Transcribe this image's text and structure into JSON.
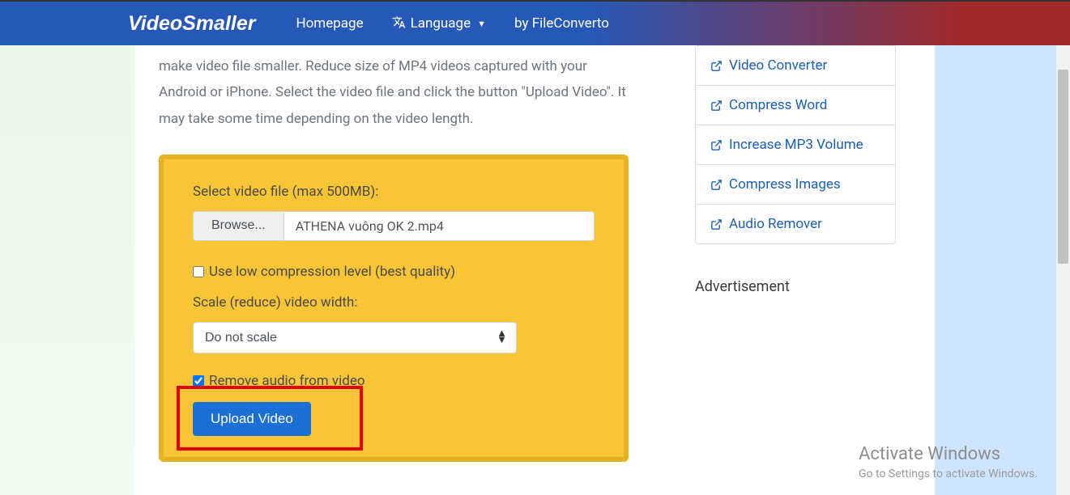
{
  "nav": {
    "brand": "VideoSmaller",
    "homepage": "Homepage",
    "language": "Language",
    "by": "by FileConverto"
  },
  "intro": "make video file smaller. Reduce size of MP4 videos captured with your Android or iPhone. Select the video file and click the button \"Upload Video\". It may take some time depending on the video length.",
  "form": {
    "selectLabel": "Select video file (max 500MB):",
    "browse": "Browse...",
    "fileName": "ATHENA vuông OK 2.mp4",
    "lowCompress": "Use low compression level (best quality)",
    "scaleLabel": "Scale (reduce) video width:",
    "scaleSelected": "Do not scale",
    "removeAudio": "Remove audio from video",
    "upload": "Upload Video"
  },
  "sidebar": {
    "links": [
      "Video Converter",
      "Compress Word",
      "Increase MP3 Volume",
      "Compress Images",
      "Audio Remover"
    ],
    "advert": "Advertisement"
  },
  "activate": {
    "title": "Activate Windows",
    "sub": "Go to Settings to activate Windows."
  }
}
